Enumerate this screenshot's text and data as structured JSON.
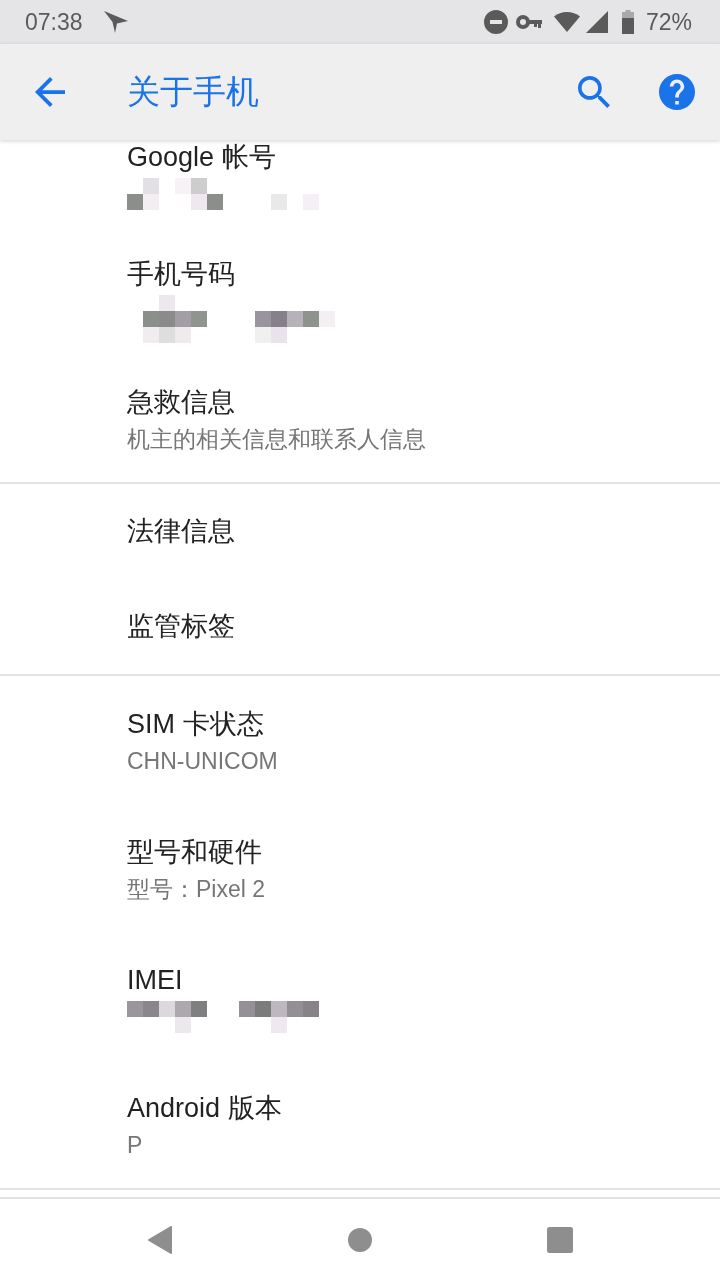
{
  "status_bar": {
    "time": "07:38",
    "battery": "72%"
  },
  "app_bar": {
    "title": "关于手机"
  },
  "sections": [
    {
      "items": [
        {
          "title": "Google 帐号",
          "redacted": true
        },
        {
          "title": "手机号码",
          "redacted": true
        },
        {
          "title": "急救信息",
          "summary": "机主的相关信息和联系人信息"
        }
      ]
    },
    {
      "items": [
        {
          "title": "法律信息"
        },
        {
          "title": "监管标签"
        }
      ]
    },
    {
      "items": [
        {
          "title": "SIM 卡状态",
          "summary": "CHN-UNICOM"
        },
        {
          "title": "型号和硬件",
          "summary": "型号：Pixel 2"
        },
        {
          "title": "IMEI",
          "redacted": true
        },
        {
          "title": "Android 版本",
          "summary": "P"
        }
      ]
    }
  ]
}
